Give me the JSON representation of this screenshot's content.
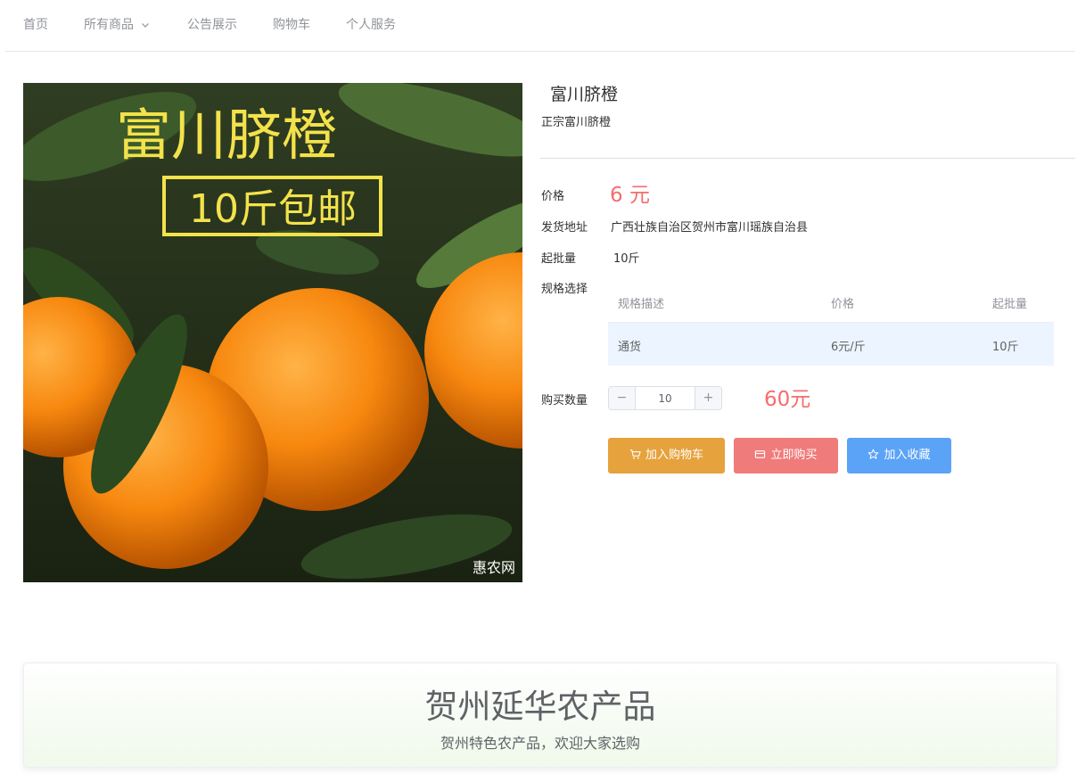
{
  "nav": {
    "items": [
      "首页",
      "所有商品",
      "公告展示",
      "购物车",
      "个人服务"
    ]
  },
  "product": {
    "image_text": {
      "line1": "富川脐橙",
      "line2": "10斤包邮",
      "watermark": "惠农网"
    },
    "title": "富川脐橙",
    "subtitle": "正宗富川脐橙",
    "price_label": "价格",
    "price": "6 元",
    "address_label": "发货地址",
    "address": "广西壮族自治区贺州市富川瑶族自治县",
    "min_batch_label": "起批量",
    "min_batch": "10斤",
    "spec_label": "规格选择",
    "spec_headers": [
      "规格描述",
      "价格",
      "起批量"
    ],
    "spec_rows": [
      [
        "通货",
        "6元/斤",
        "10斤"
      ]
    ],
    "quantity_label": "购买数量",
    "quantity": "10",
    "total": "60元",
    "buttons": {
      "cart": "加入购物车",
      "buy": "立即购买",
      "favorite": "加入收藏"
    }
  },
  "footer": {
    "title": "贺州延华农产品",
    "subtitle": "贺州特色农产品，欢迎大家选购"
  },
  "colors": {
    "price_red": "#f56c6c",
    "cart_orange": "#e6a23c",
    "buy_red": "#f07b7b",
    "fav_blue": "#5aa3f7",
    "spec_row_bg": "#ecf5ff"
  }
}
